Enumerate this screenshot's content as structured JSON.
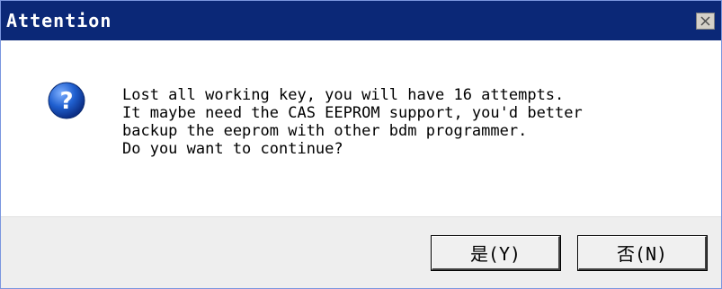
{
  "window": {
    "title": "Attention",
    "close_icon": "close-icon"
  },
  "message": {
    "icon": "question-icon",
    "lines": [
      "Lost all working key, you will have 16 attempts.",
      "It maybe need the CAS EEPROM support, you'd better",
      "backup the eeprom with other bdm programmer.",
      "Do you want to continue?"
    ]
  },
  "buttons": {
    "yes_label": "是(Y)",
    "no_label": "否(N)"
  },
  "colors": {
    "titlebar": "#0b2877",
    "footer": "#eeeeee",
    "icon_blue": "#1f5fcf"
  }
}
